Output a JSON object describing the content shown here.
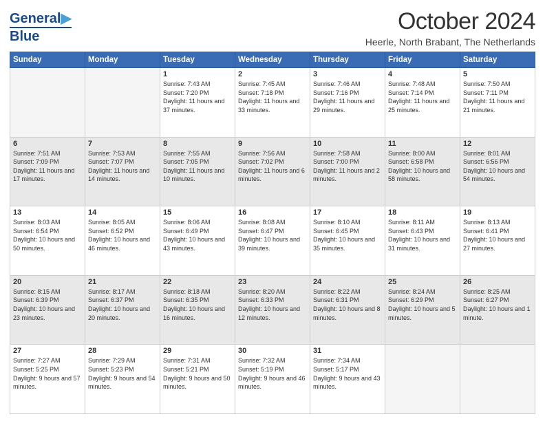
{
  "logo": {
    "line1": "General",
    "line2": "Blue"
  },
  "title": "October 2024",
  "location": "Heerle, North Brabant, The Netherlands",
  "days_of_week": [
    "Sunday",
    "Monday",
    "Tuesday",
    "Wednesday",
    "Thursday",
    "Friday",
    "Saturday"
  ],
  "weeks": [
    [
      {
        "day": "",
        "empty": true
      },
      {
        "day": "",
        "empty": true
      },
      {
        "day": "1",
        "sunrise": "7:43 AM",
        "sunset": "7:20 PM",
        "daylight": "11 hours and 37 minutes."
      },
      {
        "day": "2",
        "sunrise": "7:45 AM",
        "sunset": "7:18 PM",
        "daylight": "11 hours and 33 minutes."
      },
      {
        "day": "3",
        "sunrise": "7:46 AM",
        "sunset": "7:16 PM",
        "daylight": "11 hours and 29 minutes."
      },
      {
        "day": "4",
        "sunrise": "7:48 AM",
        "sunset": "7:14 PM",
        "daylight": "11 hours and 25 minutes."
      },
      {
        "day": "5",
        "sunrise": "7:50 AM",
        "sunset": "7:11 PM",
        "daylight": "11 hours and 21 minutes."
      }
    ],
    [
      {
        "day": "6",
        "sunrise": "7:51 AM",
        "sunset": "7:09 PM",
        "daylight": "11 hours and 17 minutes."
      },
      {
        "day": "7",
        "sunrise": "7:53 AM",
        "sunset": "7:07 PM",
        "daylight": "11 hours and 14 minutes."
      },
      {
        "day": "8",
        "sunrise": "7:55 AM",
        "sunset": "7:05 PM",
        "daylight": "11 hours and 10 minutes."
      },
      {
        "day": "9",
        "sunrise": "7:56 AM",
        "sunset": "7:02 PM",
        "daylight": "11 hours and 6 minutes."
      },
      {
        "day": "10",
        "sunrise": "7:58 AM",
        "sunset": "7:00 PM",
        "daylight": "11 hours and 2 minutes."
      },
      {
        "day": "11",
        "sunrise": "8:00 AM",
        "sunset": "6:58 PM",
        "daylight": "10 hours and 58 minutes."
      },
      {
        "day": "12",
        "sunrise": "8:01 AM",
        "sunset": "6:56 PM",
        "daylight": "10 hours and 54 minutes."
      }
    ],
    [
      {
        "day": "13",
        "sunrise": "8:03 AM",
        "sunset": "6:54 PM",
        "daylight": "10 hours and 50 minutes."
      },
      {
        "day": "14",
        "sunrise": "8:05 AM",
        "sunset": "6:52 PM",
        "daylight": "10 hours and 46 minutes."
      },
      {
        "day": "15",
        "sunrise": "8:06 AM",
        "sunset": "6:49 PM",
        "daylight": "10 hours and 43 minutes."
      },
      {
        "day": "16",
        "sunrise": "8:08 AM",
        "sunset": "6:47 PM",
        "daylight": "10 hours and 39 minutes."
      },
      {
        "day": "17",
        "sunrise": "8:10 AM",
        "sunset": "6:45 PM",
        "daylight": "10 hours and 35 minutes."
      },
      {
        "day": "18",
        "sunrise": "8:11 AM",
        "sunset": "6:43 PM",
        "daylight": "10 hours and 31 minutes."
      },
      {
        "day": "19",
        "sunrise": "8:13 AM",
        "sunset": "6:41 PM",
        "daylight": "10 hours and 27 minutes."
      }
    ],
    [
      {
        "day": "20",
        "sunrise": "8:15 AM",
        "sunset": "6:39 PM",
        "daylight": "10 hours and 23 minutes."
      },
      {
        "day": "21",
        "sunrise": "8:17 AM",
        "sunset": "6:37 PM",
        "daylight": "10 hours and 20 minutes."
      },
      {
        "day": "22",
        "sunrise": "8:18 AM",
        "sunset": "6:35 PM",
        "daylight": "10 hours and 16 minutes."
      },
      {
        "day": "23",
        "sunrise": "8:20 AM",
        "sunset": "6:33 PM",
        "daylight": "10 hours and 12 minutes."
      },
      {
        "day": "24",
        "sunrise": "8:22 AM",
        "sunset": "6:31 PM",
        "daylight": "10 hours and 8 minutes."
      },
      {
        "day": "25",
        "sunrise": "8:24 AM",
        "sunset": "6:29 PM",
        "daylight": "10 hours and 5 minutes."
      },
      {
        "day": "26",
        "sunrise": "8:25 AM",
        "sunset": "6:27 PM",
        "daylight": "10 hours and 1 minute."
      }
    ],
    [
      {
        "day": "27",
        "sunrise": "7:27 AM",
        "sunset": "5:25 PM",
        "daylight": "9 hours and 57 minutes."
      },
      {
        "day": "28",
        "sunrise": "7:29 AM",
        "sunset": "5:23 PM",
        "daylight": "9 hours and 54 minutes."
      },
      {
        "day": "29",
        "sunrise": "7:31 AM",
        "sunset": "5:21 PM",
        "daylight": "9 hours and 50 minutes."
      },
      {
        "day": "30",
        "sunrise": "7:32 AM",
        "sunset": "5:19 PM",
        "daylight": "9 hours and 46 minutes."
      },
      {
        "day": "31",
        "sunrise": "7:34 AM",
        "sunset": "5:17 PM",
        "daylight": "9 hours and 43 minutes."
      },
      {
        "day": "",
        "empty": true
      },
      {
        "day": "",
        "empty": true
      }
    ]
  ]
}
